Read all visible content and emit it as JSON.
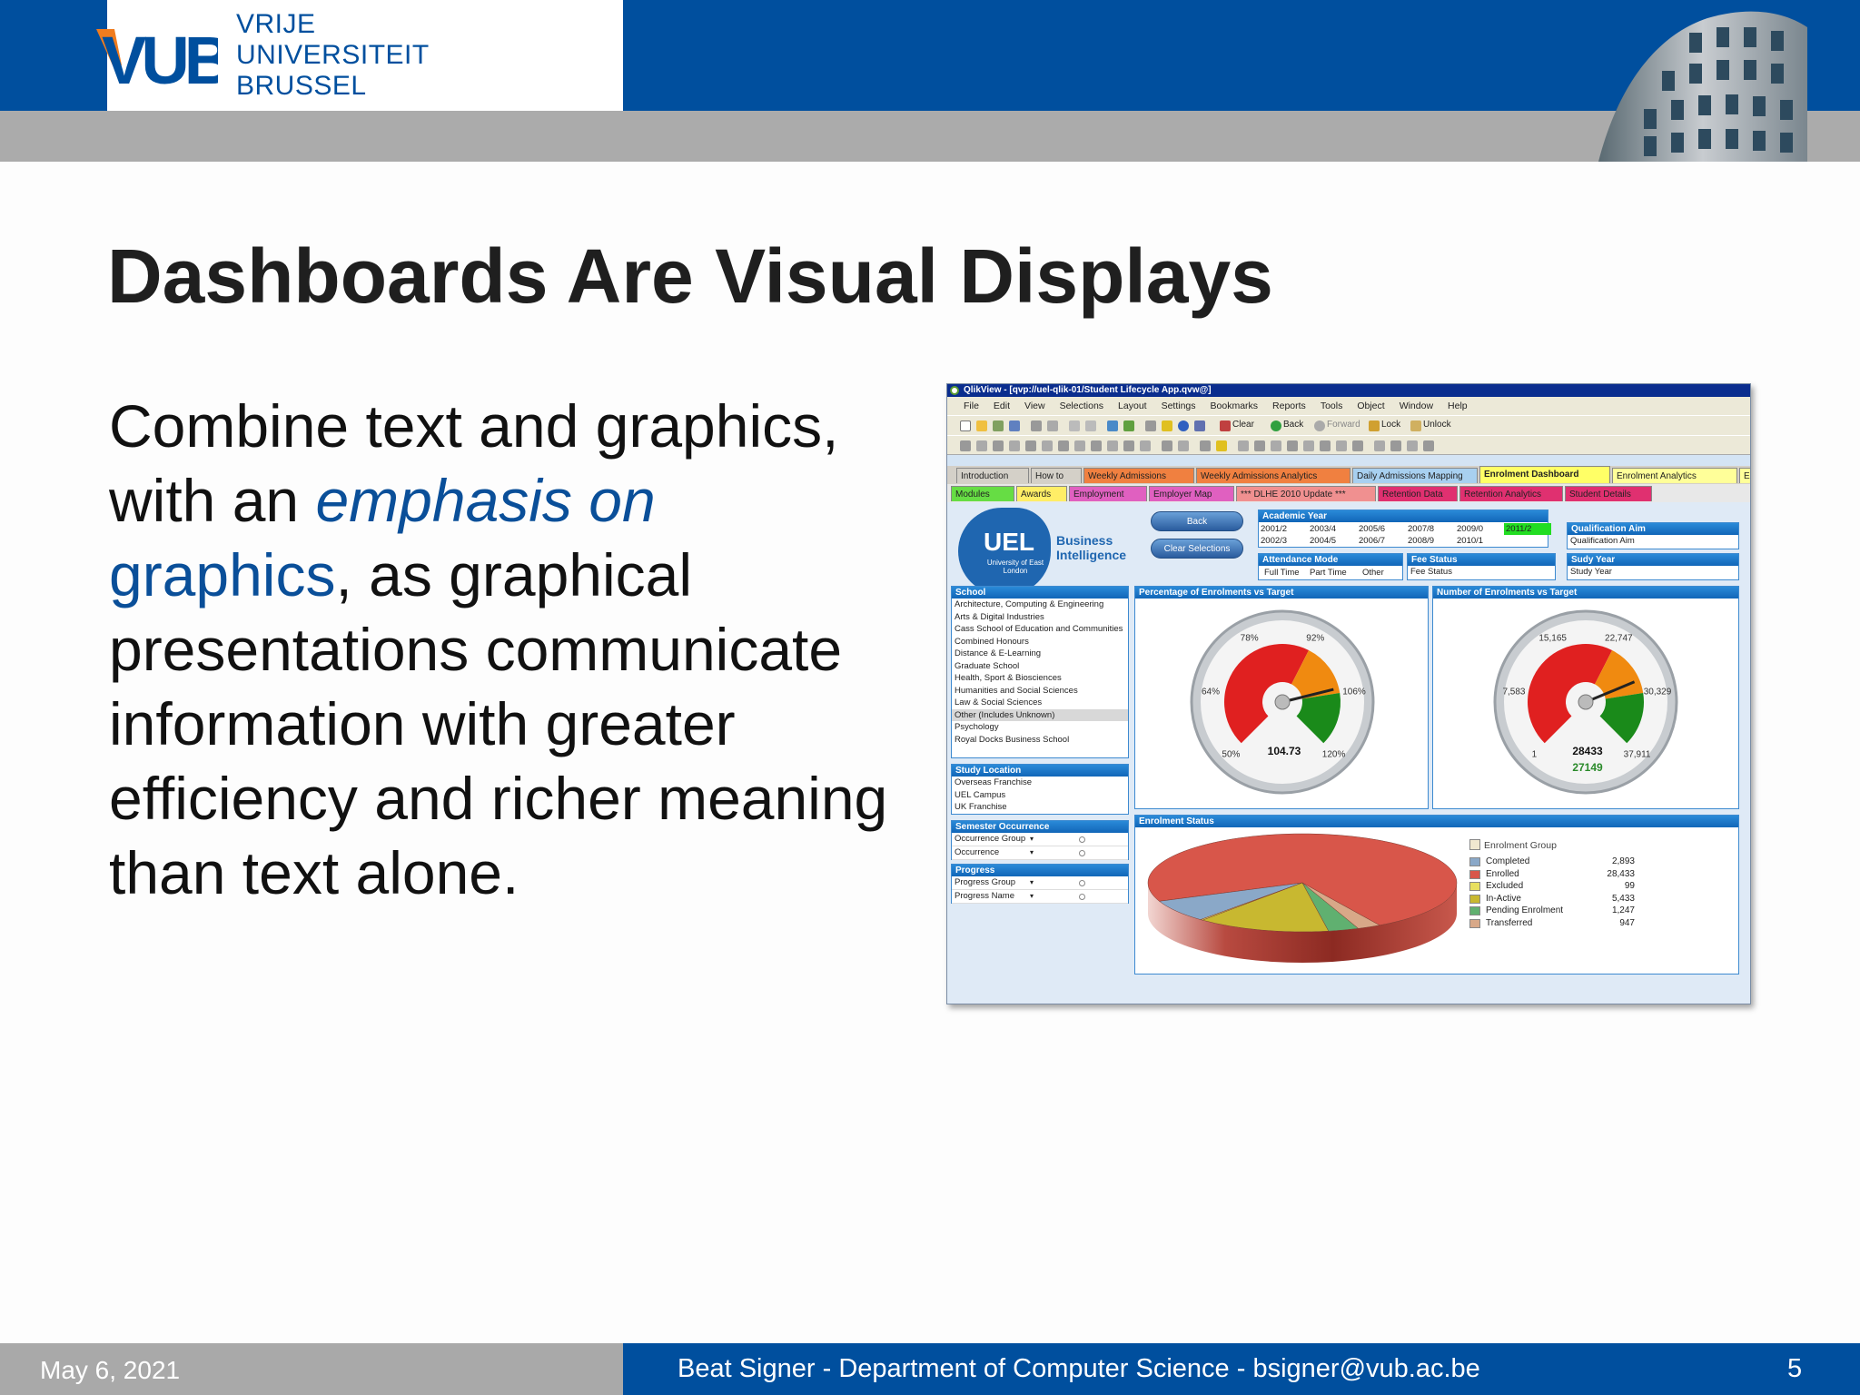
{
  "header": {
    "logo_lines": [
      "VRIJE",
      "UNIVERSITEIT",
      "BRUSSEL"
    ]
  },
  "slide": {
    "title": "Dashboards Are Visual Displays",
    "body": {
      "part1": "Combine text and graphics, with an ",
      "emphasis": "emphasis on",
      "space": " ",
      "graphics": "graphics",
      "part2": ", as graphical presentations communicate information with greater efficiency and richer meaning than text alone."
    }
  },
  "footer": {
    "date": "May 6, 2021",
    "author": "Beat Signer - Department of Computer Science - bsigner@vub.ac.be",
    "page": "5"
  },
  "qlikview": {
    "window_title": "QlikView - [qvp://uel-qlik-01/Student Lifecycle App.qvw@]",
    "menu": [
      "File",
      "Edit",
      "View",
      "Selections",
      "Layout",
      "Settings",
      "Bookmarks",
      "Reports",
      "Tools",
      "Object",
      "Window",
      "Help"
    ],
    "toolbar": {
      "clear": "Clear",
      "back": "Back",
      "forward": "Forward",
      "lock": "Lock",
      "unlock": "Unlock"
    },
    "tabs_row1": [
      {
        "label": "Introduction",
        "color": "#d4d0c8"
      },
      {
        "label": "How to",
        "color": "#d4d0c8"
      },
      {
        "label": "Weekly Admissions",
        "color": "#f08040"
      },
      {
        "label": "Weekly Admissions Analytics",
        "color": "#f08040"
      },
      {
        "label": "Daily Admissions Mapping",
        "color": "#a8d0f0"
      },
      {
        "label": "Enrolment Dashboard",
        "color": "#ffff66"
      },
      {
        "label": "Enrolment Analytics",
        "color": "#ffff99"
      },
      {
        "label": "E",
        "color": "#ffff99"
      }
    ],
    "tabs_row2": [
      {
        "label": "Modules",
        "color": "#66dd44"
      },
      {
        "label": "Awards",
        "color": "#ffee66"
      },
      {
        "label": "Employment",
        "color": "#e060c0"
      },
      {
        "label": "Employer Map",
        "color": "#e060c0"
      },
      {
        "label": "*** DLHE 2010 Update ***",
        "color": "#f09090"
      },
      {
        "label": "Retention Data",
        "color": "#e03070"
      },
      {
        "label": "Retention Analytics",
        "color": "#e03070"
      },
      {
        "label": "Student Details",
        "color": "#e03070"
      }
    ],
    "brand": {
      "uel": "UEL",
      "uel_sub": "University of East London",
      "bi_line1": "Business",
      "bi_line2": "Intelligence"
    },
    "buttons": {
      "back": "Back",
      "clear": "Clear Selections"
    },
    "academic_year": {
      "title": "Academic Year",
      "years_row1": [
        "2001/2",
        "2003/4",
        "2005/6",
        "2007/8",
        "2009/0",
        "2011/2"
      ],
      "years_row2": [
        "2002/3",
        "2004/5",
        "2006/7",
        "2008/9",
        "2010/1"
      ]
    },
    "attendance": {
      "title": "Attendance Mode",
      "options": [
        "Full Time",
        "Part Time",
        "Other"
      ]
    },
    "fee_status": {
      "title": "Fee Status",
      "field": "Fee Status"
    },
    "qual_aim": {
      "title": "Qualification Aim",
      "field": "Qualification Aim"
    },
    "study_year": {
      "title": "Sudy Year",
      "field": "Study Year"
    },
    "school": {
      "title": "School",
      "items": [
        "Architecture, Computing & Engineering",
        "Arts & Digital Industries",
        "Cass School of Education and Communities",
        "Combined Honours",
        "Distance & E-Learning",
        "Graduate School",
        "Health, Sport & Biosciences",
        "Humanities and Social Sciences",
        "Law & Social Sciences",
        "Other (Includes Unknown)",
        "Psychology",
        "Royal Docks Business School"
      ],
      "selected_index": 9
    },
    "study_location": {
      "title": "Study Location",
      "items": [
        "Overseas Franchise",
        "UEL Campus",
        "UK Franchise"
      ]
    },
    "semester": {
      "title": "Semester Occurrence",
      "rows": [
        "Occurrence Group",
        "Occurrence"
      ]
    },
    "progress": {
      "title": "Progress",
      "rows": [
        "Progress Group",
        "Progress Name"
      ]
    },
    "gauge1": {
      "title": "Percentage of Enrolments vs Target",
      "labels": [
        "50%",
        "64%",
        "78%",
        "92%",
        "106%",
        "120%"
      ],
      "value_text": "104.73",
      "value": 104.73,
      "min": 50,
      "max": 120
    },
    "gauge2": {
      "title": "Number of Enrolments vs Target",
      "labels": [
        "1",
        "7,583",
        "15,165",
        "22,747",
        "30,329",
        "37,911"
      ],
      "value_text": "28433",
      "target_text": "27149",
      "value": 28433,
      "min": 1,
      "max": 37911
    },
    "enrolment_status": {
      "title": "Enrolment Status",
      "legend_title": "Enrolment Group"
    },
    "chart_data": {
      "type": "pie",
      "title": "Enrolment Status",
      "legend_title": "Enrolment Group",
      "categories": [
        "Completed",
        "Enrolled",
        "Excluded",
        "In-Active",
        "Pending Enrolment",
        "Transferred"
      ],
      "values": [
        2893,
        28433,
        99,
        5433,
        1247,
        947
      ],
      "value_labels": [
        "2,893",
        "28,433",
        "99",
        "5,433",
        "1,247",
        "947"
      ],
      "colors": [
        "#8aa8c8",
        "#d8564a",
        "#e8e060",
        "#c8b830",
        "#60b070",
        "#d8a888"
      ]
    }
  }
}
